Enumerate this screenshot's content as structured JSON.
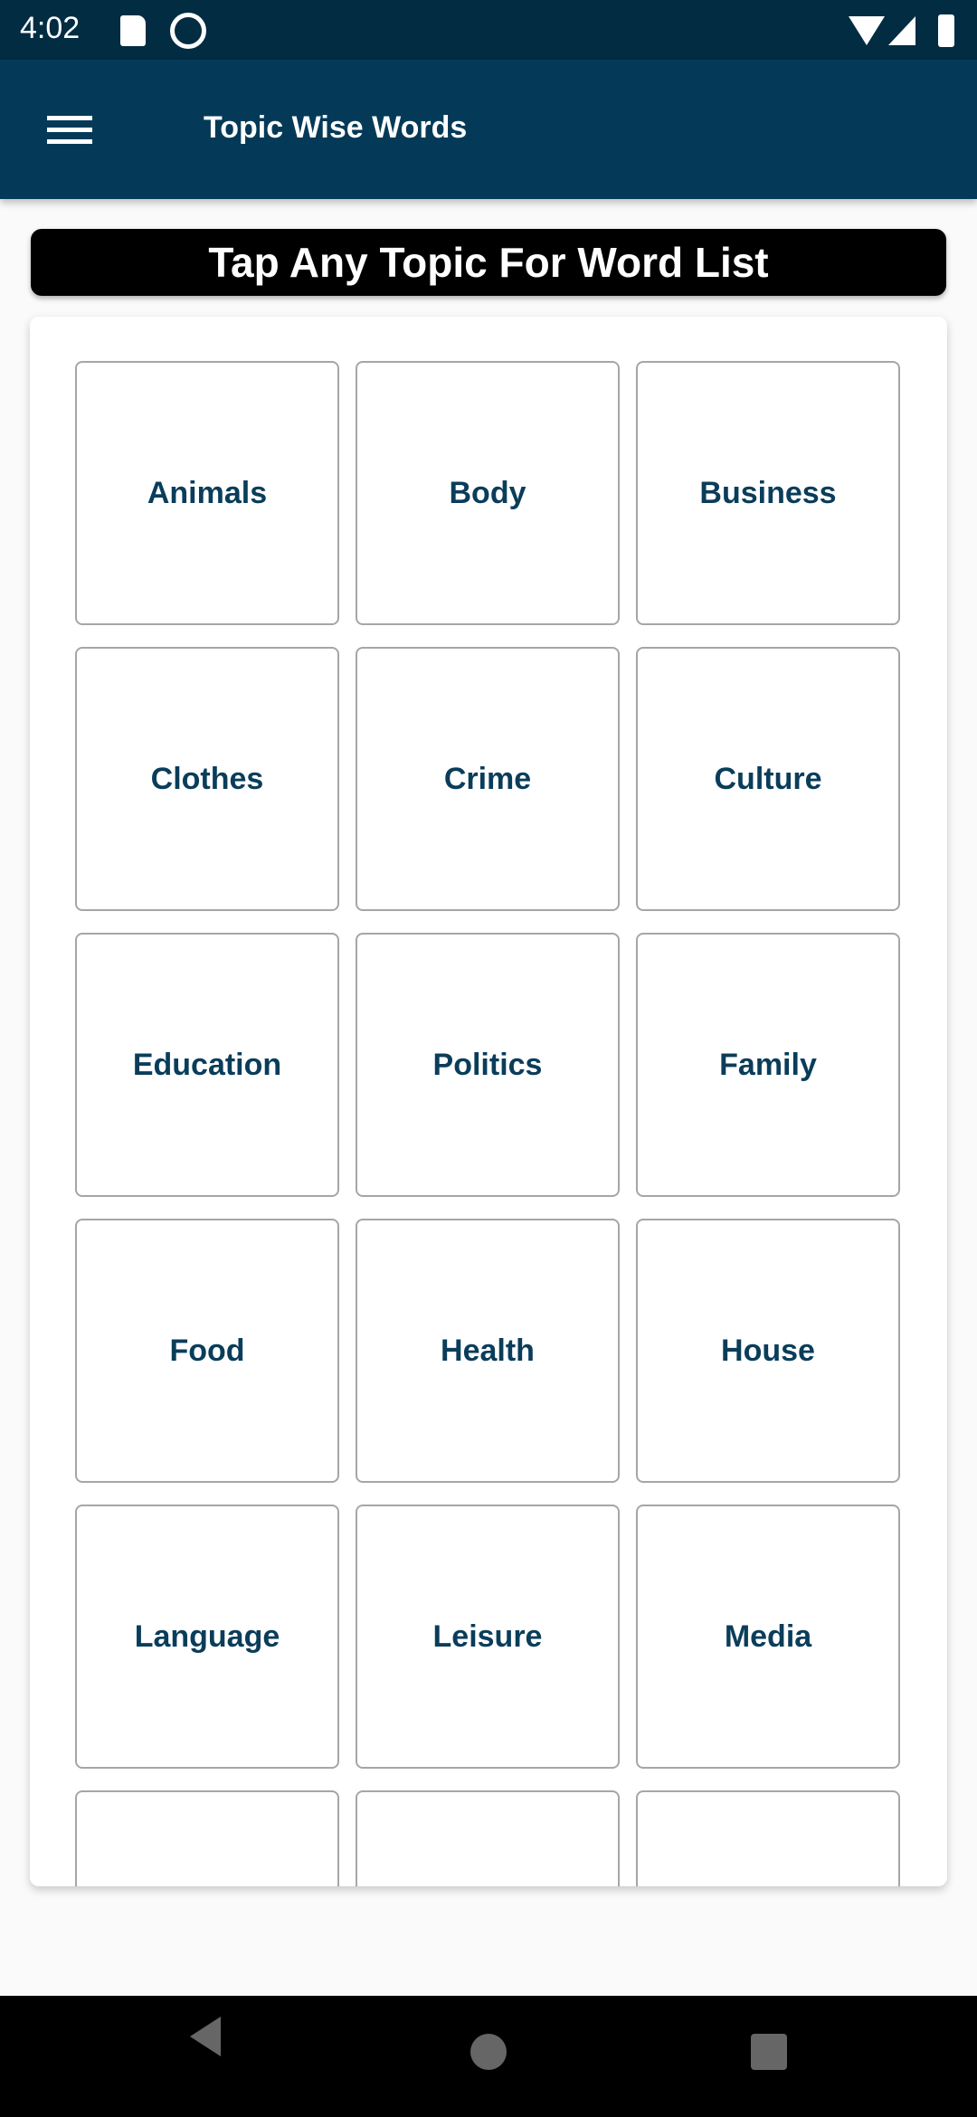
{
  "status_bar": {
    "time": "4:02",
    "icons": [
      "sd-card-icon",
      "data-saver-icon",
      "wifi-icon",
      "signal-icon",
      "battery-icon"
    ]
  },
  "app_bar": {
    "title": "Topic Wise Words",
    "menu_icon": "hamburger-menu-icon",
    "color": "#043a58"
  },
  "banner": {
    "text": "Tap Any Topic For Word List"
  },
  "topics": [
    "Animals",
    "Body",
    "Business",
    "Clothes",
    "Crime",
    "Culture",
    "Education",
    "Politics",
    "Family",
    "Food",
    "Health",
    "House",
    "Language",
    "Leisure",
    "Media",
    "",
    "",
    ""
  ],
  "colors": {
    "tile_text": "#0a3d5a",
    "status_bar": "#022c42"
  },
  "nav_bar": {
    "icons": [
      "back-icon",
      "home-icon",
      "recents-icon"
    ]
  }
}
